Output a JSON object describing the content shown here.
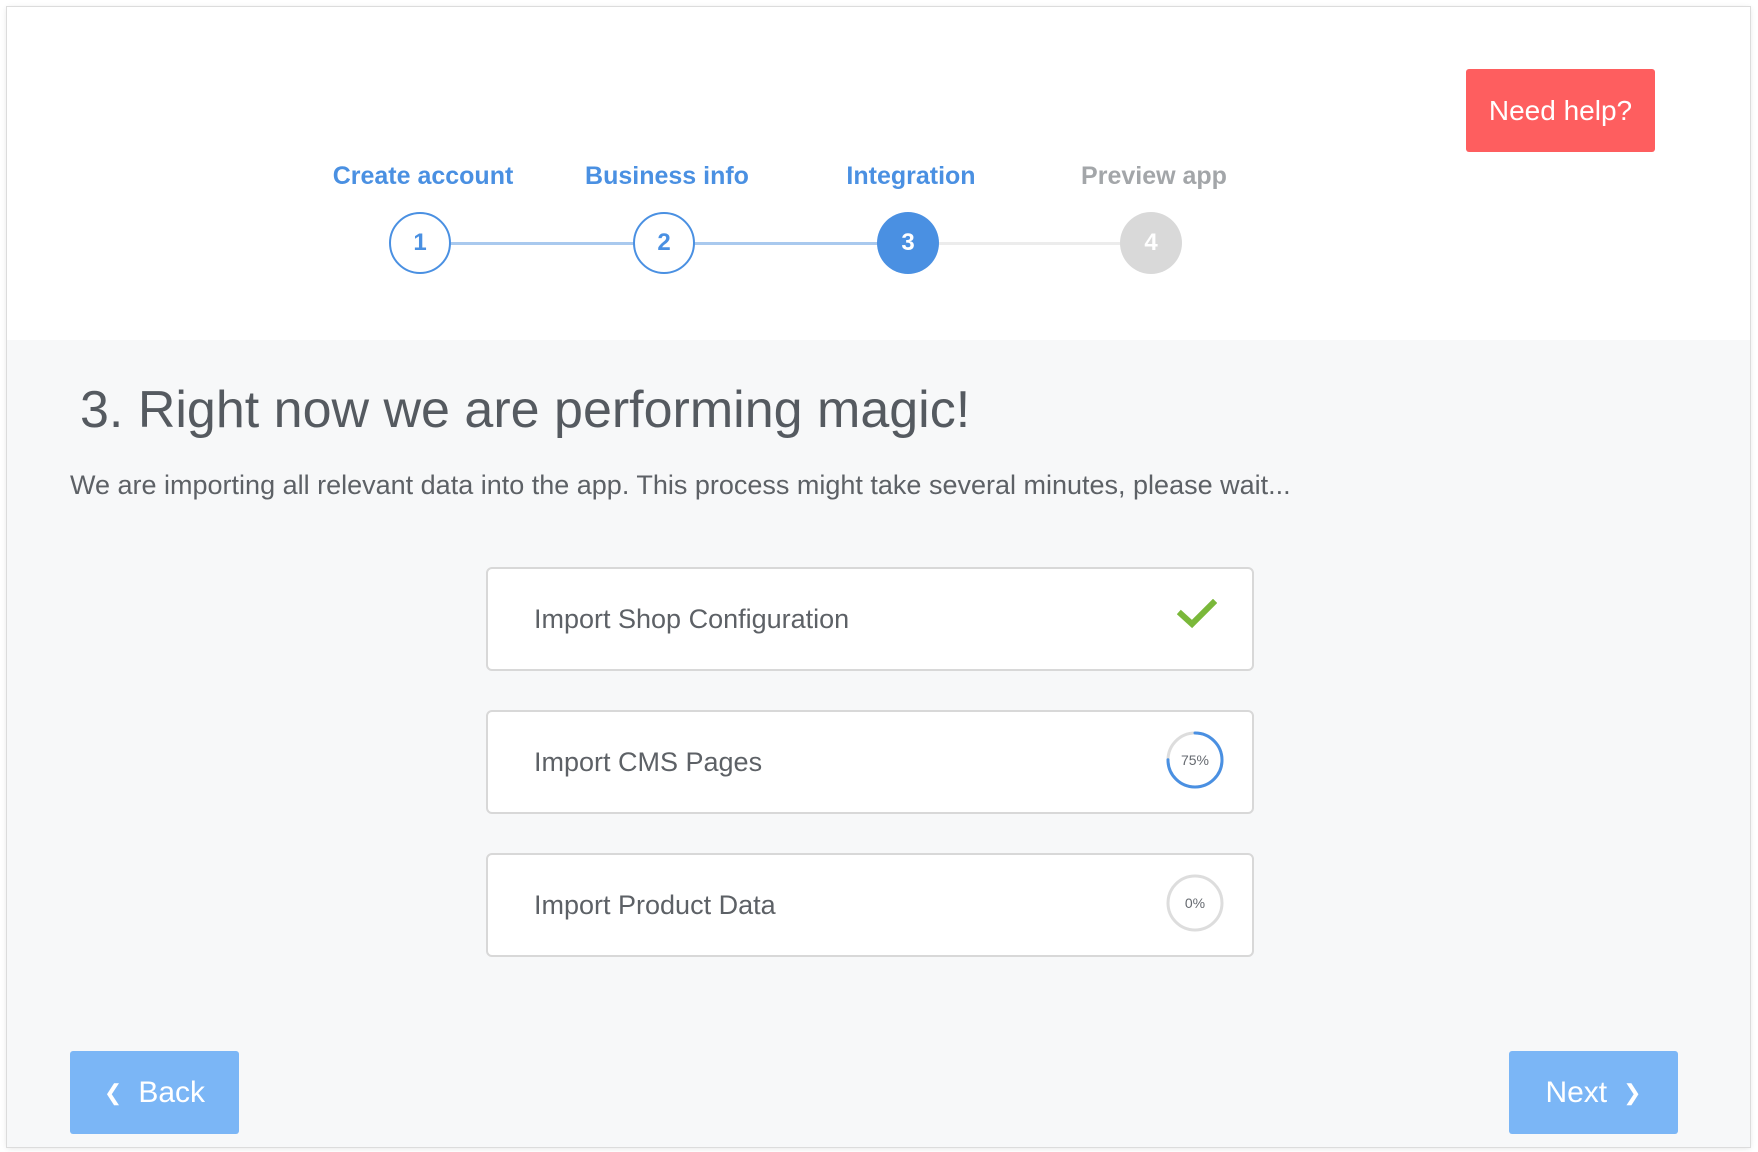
{
  "header": {
    "help_label": "Need help?"
  },
  "steps": [
    {
      "label": "Create account",
      "number": "1",
      "state": "done"
    },
    {
      "label": "Business info",
      "number": "2",
      "state": "done"
    },
    {
      "label": "Integration",
      "number": "3",
      "state": "active"
    },
    {
      "label": "Preview app",
      "number": "4",
      "state": "todo"
    }
  ],
  "main": {
    "title": "3. Right now we are performing magic!",
    "subtitle": "We are importing all relevant data into the app. This process might take several minutes, please wait..."
  },
  "tasks": [
    {
      "label": "Import Shop Configuration",
      "status": "complete",
      "status_icon": "check-icon"
    },
    {
      "label": "Import CMS Pages",
      "status": "in-progress",
      "progress_text": "75%",
      "progress": 0.75
    },
    {
      "label": "Import Product Data",
      "status": "pending",
      "progress_text": "0%",
      "progress": 0
    }
  ],
  "footer": {
    "back_label": "Back",
    "next_label": "Next"
  },
  "colors": {
    "accent": "#4a90e2",
    "help": "#fe5e5f",
    "nav_button": "#7bb6f6",
    "complete": "#7ab83a",
    "inactive": "#d9d9d9"
  }
}
